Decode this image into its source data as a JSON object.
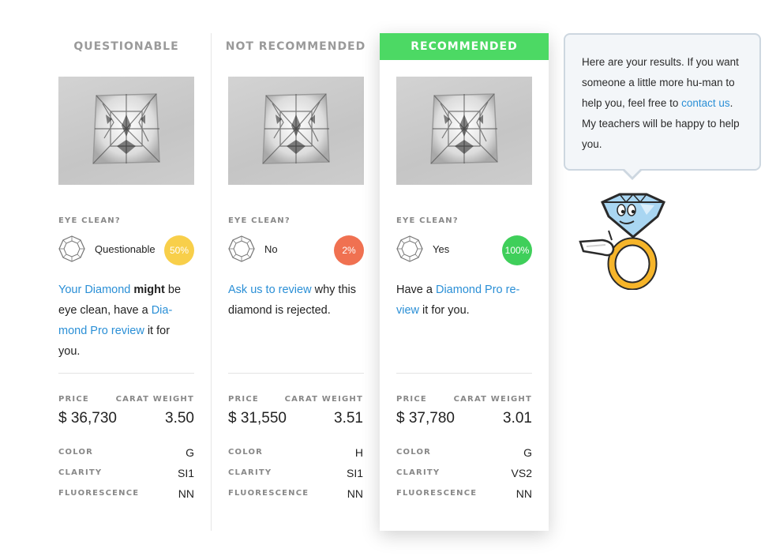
{
  "columns": [
    {
      "header": "QUESTIONABLE",
      "eye_label": "EYE CLEAN?",
      "eye_value": "Questionable",
      "percent": "50%",
      "percent_color": "#f8cf4a",
      "desc": [
        {
          "t": "link",
          "text": "Your Diamond"
        },
        {
          "t": "text",
          "text": " "
        },
        {
          "t": "bold",
          "text": "might"
        },
        {
          "t": "text",
          "text": " be eye clean, have a "
        },
        {
          "t": "link",
          "text": "Dia-mond Pro review"
        },
        {
          "t": "text",
          "text": " it for you."
        }
      ],
      "price_label": "PRICE",
      "carat_label": "CARAT WEIGHT",
      "price": "$ 36,730",
      "carat": "3.50",
      "color_label": "COLOR",
      "color": "G",
      "clarity_label": "CLARITY",
      "clarity": "SI1",
      "fluor_label": "FLUORESCENCE",
      "fluor": "NN"
    },
    {
      "header": "NOT RECOMMENDED",
      "eye_label": "EYE CLEAN?",
      "eye_value": "No",
      "percent": "2%",
      "percent_color": "#f07151",
      "desc": [
        {
          "t": "link",
          "text": "Ask us to review"
        },
        {
          "t": "text",
          "text": " why this diamond is rejected."
        }
      ],
      "price_label": "PRICE",
      "carat_label": "CARAT WEIGHT",
      "price": "$ 31,550",
      "carat": "3.51",
      "color_label": "COLOR",
      "color": "H",
      "clarity_label": "CLARITY",
      "clarity": "SI1",
      "fluor_label": "FLUORESCENCE",
      "fluor": "NN"
    },
    {
      "header": "RECOMMENDED",
      "eye_label": "EYE CLEAN?",
      "eye_value": "Yes",
      "percent": "100%",
      "percent_color": "#3fcf5a",
      "desc": [
        {
          "t": "text",
          "text": "Have a "
        },
        {
          "t": "link",
          "text": "Diamond Pro re-view"
        },
        {
          "t": "text",
          "text": " it for you."
        }
      ],
      "price_label": "PRICE",
      "carat_label": "CARAT WEIGHT",
      "price": "$ 37,780",
      "carat": "3.01",
      "color_label": "COLOR",
      "color": "G",
      "clarity_label": "CLARITY",
      "clarity": "VS2",
      "fluor_label": "FLUORESCENCE",
      "fluor": "NN"
    }
  ],
  "bubble": {
    "before": "Here are your results. If you want someone a little more hu-man to help you, feel free to ",
    "link": "contact us",
    "after": ". My teachers will be happy to help you."
  },
  "colors": {
    "link": "#2a8fd6",
    "recommended": "#4cd964"
  },
  "icons": {
    "diamond_outline": "diamond-outline-icon",
    "mascot": "ring-mascot"
  }
}
